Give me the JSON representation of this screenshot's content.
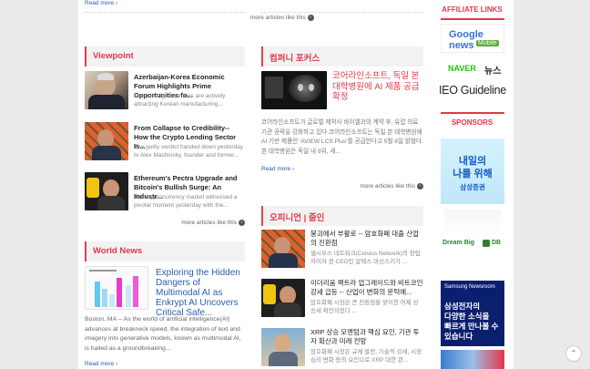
{
  "top": {
    "read_more": "Read more ›",
    "more_like": "more articles like this"
  },
  "viewpoint": {
    "title": "Viewpoint",
    "items": [
      {
        "title": "Azerbaijan-Korea Economic Forum Highlights Prime Opportunities fo...",
        "desc": "Many foreign countries are actively attracting Korean manufacturing..."
      },
      {
        "title": "From Collapse to Credibility-- How the Crypto Lending Sector Is...",
        "desc": "The guilty verdict handed down yesterday to Alex Mashinsky, founder and former..."
      },
      {
        "title": "Ethereum's Pectra Upgrade and Bitcoin's Bullish Surge: An Industr...",
        "desc": "The cryptocurrency market witnessed a pivotal moment yesterday with the..."
      }
    ],
    "more_like": "more articles like this"
  },
  "world_news": {
    "title": "World News",
    "headline": "Exploring the Hidden Dangers of Multimodal AI as Enkrypt AI Uncovers Critical Safe...",
    "body": "Boston, MA -- As the world of artificial intelligence(AI) advances at breakneck speed, the integration of text and imagery into generative models, known as multimodal AI, is hailed as a groundbreaking...",
    "read_more": "Read more ›"
  },
  "company_focus": {
    "title": "컴퍼니 포커스",
    "headline": "코어라인소프트, 독일 본 대학병원에 AI 제품 공급 확정",
    "body": "코어라인소프트가 글로벌 제약사 바이엘과의 계약 후, 유럽 의료기관 공략을 강화하고 있다.코어라인소프트는 독일 본 대학병원에 AI 기반 제품인 'AVIEW LCS Plus'를 공급한다고 5월 8일 밝혔다. 본 대학병원은 독일 내 9위, 세...",
    "read_more": "Read more ›",
    "more_like": "more articles like this"
  },
  "opinion": {
    "title": "오피니언 | 줌인",
    "items": [
      {
        "title": "붕괴에서 부활로 -- 암호화폐 대출 산업의 진환점",
        "desc": "셀시우스 네트워크(Celsius Network)의 창립자이자 전 CEO인 알렉스 마신스키가 ..."
      },
      {
        "title": "이더리움 펙트라 업그레이드와 비트코인 강세 급등 -- 산업이 변화의 문턱에...",
        "desc": "암호화폐 시장은 큰 진환점을 맞이한 어제 상승세 확인되었다 ..."
      },
      {
        "title": "XRP 상승 모멘텀과 핵심 요인, 기관 투자 확산과 미래 전망",
        "desc": "암호화폐 시장은 규제 발전, 기술적 강세, 시장 심리 변화 등의 요인으로 XRP 대한 관..."
      }
    ]
  },
  "sidebar": {
    "affiliate_title": "AFFILIATE LINKS",
    "google_news": "Google news",
    "google_mobile": "Mobile",
    "naver": "NAVER",
    "naver_news": "뉴스",
    "ieo": "IEO Guideline",
    "sponsors_title": "SPONSORS",
    "samsung_ad": {
      "line1": "내일의",
      "line2": "나를 위해",
      "brand": "삼성증권"
    },
    "db_ad": {
      "slogan": "Dream Big",
      "brand": "DB"
    },
    "newsroom_ad": {
      "brand": "Samsung Newsroom",
      "line1": "삼성전자의",
      "line2": "다양한 소식을",
      "line3": "빠르게 만나볼 수",
      "line4": "있습니다"
    }
  },
  "scroll_top": "⌃"
}
